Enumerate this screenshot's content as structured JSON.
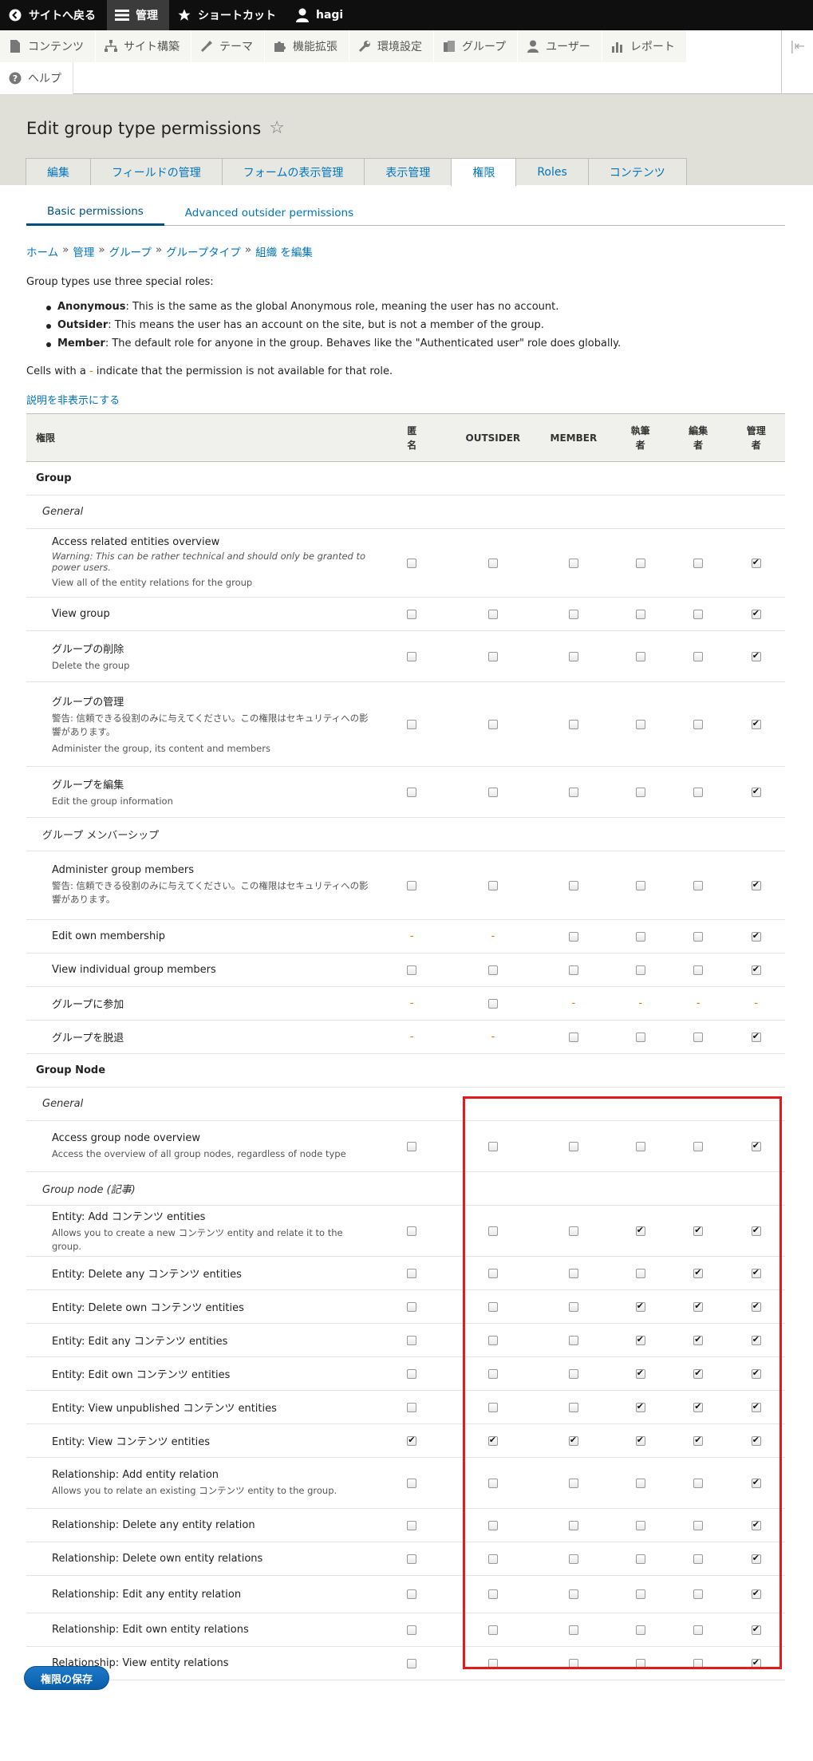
{
  "toolbar": {
    "back": "サイトへ戻る",
    "manage": "管理",
    "shortcuts": "ショートカット",
    "user": "hagi"
  },
  "tray": {
    "items": [
      "コンテンツ",
      "サイト構築",
      "テーマ",
      "機能拡張",
      "環境設定",
      "グループ",
      "ユーザー",
      "レポート"
    ],
    "help": "ヘルプ"
  },
  "page": {
    "title": "Edit group type permissions"
  },
  "tabs": [
    "編集",
    "フィールドの管理",
    "フォームの表示管理",
    "表示管理",
    "権限",
    "Roles",
    "コンテンツ"
  ],
  "subtabs": [
    "Basic permissions",
    "Advanced outsider permissions"
  ],
  "breadcrumb": [
    "ホーム",
    "管理",
    "グループ",
    "グループタイプ",
    "組織 を編集"
  ],
  "breadcrumb_sep": "»",
  "intro": "Group types use three special roles:",
  "roles": [
    {
      "name": "Anonymous",
      "text": ": This is the same as the global Anonymous role, meaning the user has no account."
    },
    {
      "name": "Outsider",
      "text": ": This means the user has an account on the site, but is not a member of the group."
    },
    {
      "name": "Member",
      "text": ": The default role for anyone in the group. Behaves like the \"Authenticated user\" role does globally."
    }
  ],
  "cells_note": {
    "before": "Cells with a ",
    "dash": "-",
    "after": " indicate that the permission is not available for that role."
  },
  "hide_desc": "説明を非表示にする",
  "table": {
    "headers": [
      "権限",
      "匿\n名",
      "OUTSIDER",
      "MEMBER",
      "執筆\n者",
      "編集\n者",
      "管理\n者"
    ],
    "rows": [
      {
        "kind": "module",
        "label": "Group"
      },
      {
        "kind": "section",
        "label": "General"
      },
      {
        "kind": "perm",
        "title": "Access related entities overview",
        "warning": "Warning: This can be rather technical and should only be granted to power users.",
        "desc": "View all of the entity relations for the group",
        "v": [
          0,
          0,
          0,
          0,
          0,
          1
        ]
      },
      {
        "kind": "perm",
        "title": "View group",
        "v": [
          0,
          0,
          0,
          0,
          0,
          1
        ]
      },
      {
        "kind": "perm",
        "title": "グループの削除",
        "desc": "Delete the group",
        "v": [
          0,
          0,
          0,
          0,
          0,
          1
        ]
      },
      {
        "kind": "perm",
        "title": "グループの管理",
        "desc": "警告: 信頼できる役割のみに与えてください。この権限はセキュリティへの影響があります。\nAdminister the group, its content and members",
        "v": [
          0,
          0,
          0,
          0,
          0,
          1
        ]
      },
      {
        "kind": "perm",
        "title": "グループを編集",
        "desc": "Edit the group information",
        "v": [
          0,
          0,
          0,
          0,
          0,
          1
        ]
      },
      {
        "kind": "section-plain",
        "label": "グループ メンバーシップ"
      },
      {
        "kind": "perm",
        "title": "Administer group members",
        "desc": "警告: 信頼できる役割のみに与えてください。この権限はセキュリティへの影響があります。",
        "v": [
          0,
          0,
          0,
          0,
          0,
          1
        ]
      },
      {
        "kind": "perm",
        "title": "Edit own membership",
        "v": [
          "-",
          "-",
          0,
          0,
          0,
          1
        ]
      },
      {
        "kind": "perm",
        "title": "View individual group members",
        "v": [
          0,
          0,
          0,
          0,
          0,
          1
        ]
      },
      {
        "kind": "perm",
        "title": "グループに参加",
        "v": [
          "-",
          0,
          "-",
          "-",
          "-",
          "-"
        ]
      },
      {
        "kind": "perm",
        "title": "グループを脱退",
        "v": [
          "-",
          "-",
          0,
          0,
          0,
          1
        ]
      },
      {
        "kind": "module",
        "label": "Group Node"
      },
      {
        "kind": "section",
        "label": "General"
      },
      {
        "kind": "perm",
        "title": "Access group node overview",
        "desc": "Access the overview of all group nodes, regardless of node type",
        "v": [
          0,
          0,
          0,
          0,
          0,
          1
        ]
      },
      {
        "kind": "section",
        "label": "Group node (記事)"
      },
      {
        "kind": "perm",
        "title": "Entity: Add コンテンツ entities",
        "desc": "Allows you to create a new コンテンツ entity and relate it to the group.",
        "v": [
          0,
          0,
          0,
          1,
          1,
          1
        ]
      },
      {
        "kind": "perm",
        "title": "Entity: Delete any コンテンツ entities",
        "v": [
          0,
          0,
          0,
          0,
          1,
          1
        ]
      },
      {
        "kind": "perm",
        "title": "Entity: Delete own コンテンツ entities",
        "v": [
          0,
          0,
          0,
          1,
          1,
          1
        ]
      },
      {
        "kind": "perm",
        "title": "Entity: Edit any コンテンツ entities",
        "v": [
          0,
          0,
          0,
          1,
          1,
          1
        ]
      },
      {
        "kind": "perm",
        "title": "Entity: Edit own コンテンツ entities",
        "v": [
          0,
          0,
          0,
          1,
          1,
          1
        ]
      },
      {
        "kind": "perm",
        "title": "Entity: View unpublished コンテンツ entities",
        "v": [
          0,
          0,
          0,
          1,
          1,
          1
        ]
      },
      {
        "kind": "perm",
        "title": "Entity: View コンテンツ entities",
        "v": [
          1,
          1,
          1,
          1,
          1,
          1
        ]
      },
      {
        "kind": "perm",
        "title": "Relationship: Add entity relation",
        "desc": "Allows you to relate an existing コンテンツ entity to the group.",
        "v": [
          0,
          0,
          0,
          0,
          0,
          1
        ]
      },
      {
        "kind": "perm",
        "title": "Relationship: Delete any entity relation",
        "v": [
          0,
          0,
          0,
          0,
          0,
          1
        ]
      },
      {
        "kind": "perm",
        "title": "Relationship: Delete own entity relations",
        "v": [
          0,
          0,
          0,
          0,
          0,
          1
        ]
      },
      {
        "kind": "perm",
        "title": "Relationship: Edit any entity relation",
        "v": [
          0,
          0,
          0,
          0,
          0,
          1
        ]
      },
      {
        "kind": "perm",
        "title": "Relationship: Edit own entity relations",
        "v": [
          0,
          0,
          0,
          0,
          0,
          1
        ]
      },
      {
        "kind": "perm",
        "title": "Relationship: View entity relations",
        "v": [
          0,
          0,
          0,
          0,
          0,
          1
        ]
      }
    ]
  },
  "save_label": "権限の保存",
  "colors": {
    "accent": "#0074bd",
    "highlight": "#e41919",
    "unavailable": "#e56c00"
  }
}
